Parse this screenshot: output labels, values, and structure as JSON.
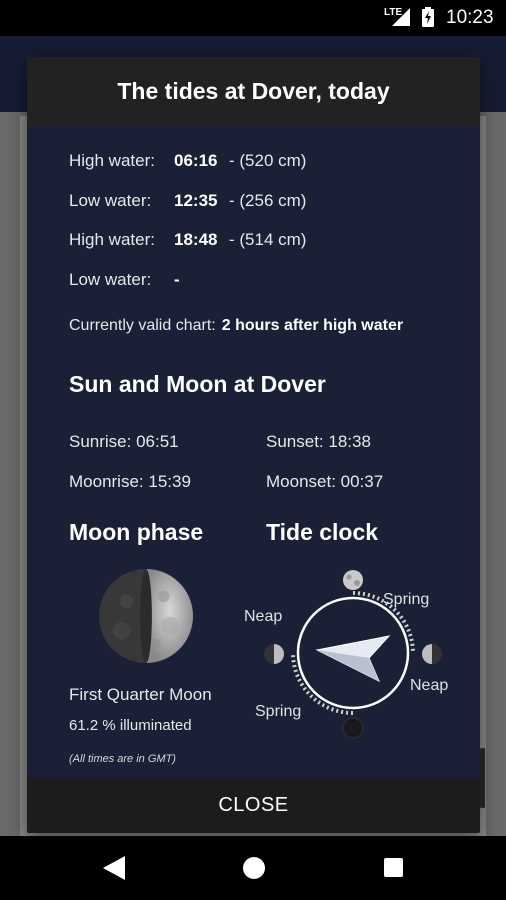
{
  "status_bar": {
    "network": "LTE",
    "time": "10:23"
  },
  "dialog": {
    "title": "The tides at Dover, today",
    "tides": [
      {
        "label": "High water:",
        "time": "06:16",
        "height": "- (520 cm)"
      },
      {
        "label": "Low water:",
        "time": "12:35",
        "height": "- (256 cm)"
      },
      {
        "label": "High water:",
        "time": "18:48",
        "height": "- (514 cm)"
      },
      {
        "label": "Low water:",
        "time": "-",
        "height": ""
      }
    ],
    "valid_chart_label": "Currently valid chart:",
    "valid_chart_value": "2 hours after high water",
    "sun_moon_title": "Sun and Moon at Dover",
    "sunrise": "Sunrise: 06:51",
    "sunset": "Sunset: 18:38",
    "moonrise": "Moonrise: 15:39",
    "moonset": "Moonset: 00:37",
    "moon_phase_title": "Moon phase",
    "tide_clock_title": "Tide clock",
    "moon_phase_name": "First Quarter Moon",
    "illumination": "61.2 % illuminated",
    "footnote": "(All times are in GMT)",
    "tide_clock": {
      "spring_label": "Spring",
      "neap_label": "Neap"
    },
    "close_label": "CLOSE"
  },
  "colors": {
    "dialog_bg": "#1a2035",
    "title_bar_bg": "#222222",
    "status_bar_bg": "#000000"
  }
}
